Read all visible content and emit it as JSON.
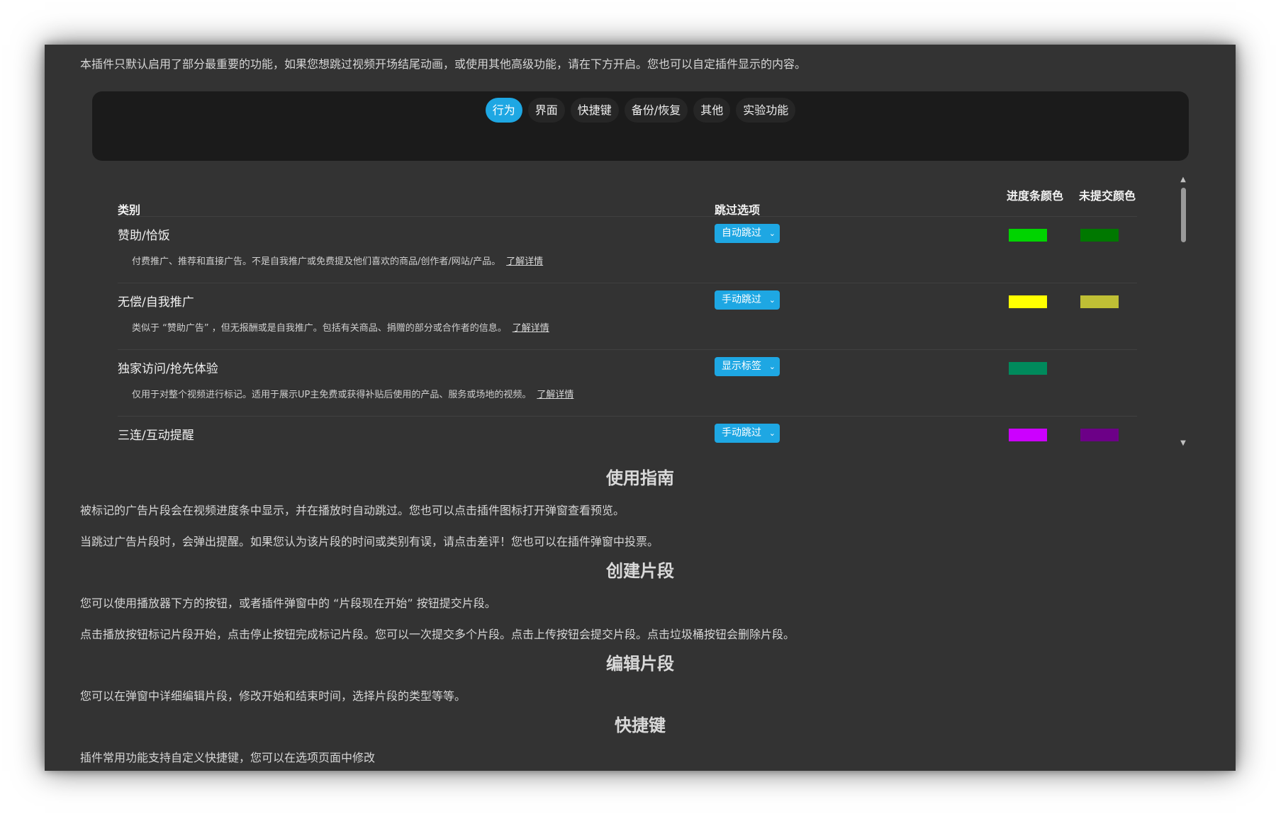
{
  "intro": "本插件只默认启用了部分最重要的功能，如果您想跳过视频开场结尾动画，或使用其他高级功能，请在下方开启。您也可以自定插件显示的内容。",
  "tabs": [
    {
      "label": "行为",
      "active": true
    },
    {
      "label": "界面",
      "active": false
    },
    {
      "label": "快捷键",
      "active": false
    },
    {
      "label": "备份/恢复",
      "active": false
    },
    {
      "label": "其他",
      "active": false
    },
    {
      "label": "实验功能",
      "active": false
    }
  ],
  "table": {
    "headers": {
      "category": "类别",
      "skip_option": "跳过选项",
      "bar_color": "进度条颜色",
      "unsubmitted_color": "未提交颜色"
    },
    "link_label": "了解详情",
    "rows": [
      {
        "name": "赞助/恰饭",
        "desc": "付费推广、推荐和直接广告。不是自我推广或免费提及他们喜欢的商品/创作者/网站/产品。",
        "option": "自动跳过",
        "bar_color": "#00d400",
        "unsubmitted_color": "#007800"
      },
      {
        "name": "无偿/自我推广",
        "desc": "类似于 “赞助广告” ，但无报酬或是自我推广。包括有关商品、捐赠的部分或合作者的信息。",
        "option": "手动跳过",
        "bar_color": "#ffff00",
        "unsubmitted_color": "#bfbf35"
      },
      {
        "name": "独家访问/抢先体验",
        "desc": "仅用于对整个视频进行标记。适用于展示UP主免费或获得补贴后使用的产品、服务或场地的视频。",
        "option": "显示标签",
        "bar_color": "#008a5c",
        "unsubmitted_color": ""
      },
      {
        "name": "三连/互动提醒",
        "desc": "",
        "option": "手动跳过",
        "bar_color": "#cc00ff",
        "unsubmitted_color": "#6c0087"
      }
    ]
  },
  "sections": [
    {
      "title": "使用指南",
      "paragraphs": [
        "被标记的广告片段会在视频进度条中显示，并在播放时自动跳过。您也可以点击插件图标打开弹窗查看预览。",
        "当跳过广告片段时，会弹出提醒。如果您认为该片段的时间或类别有误，请点击差评！您也可以在插件弹窗中投票。"
      ]
    },
    {
      "title": "创建片段",
      "paragraphs": [
        "您可以使用播放器下方的按钮，或者插件弹窗中的 “片段现在开始” 按钮提交片段。",
        "点击播放按钮标记片段开始，点击停止按钮完成标记片段。您可以一次提交多个片段。点击上传按钮会提交片段。点击垃圾桶按钮会删除片段。"
      ]
    },
    {
      "title": "编辑片段",
      "paragraphs": [
        "您可以在弹窗中详细编辑片段，修改开始和结束时间，选择片段的类型等等。"
      ]
    },
    {
      "title": "快捷键",
      "paragraphs": [
        "插件常用功能支持自定义快捷键，您可以在选项页面中修改"
      ]
    }
  ]
}
